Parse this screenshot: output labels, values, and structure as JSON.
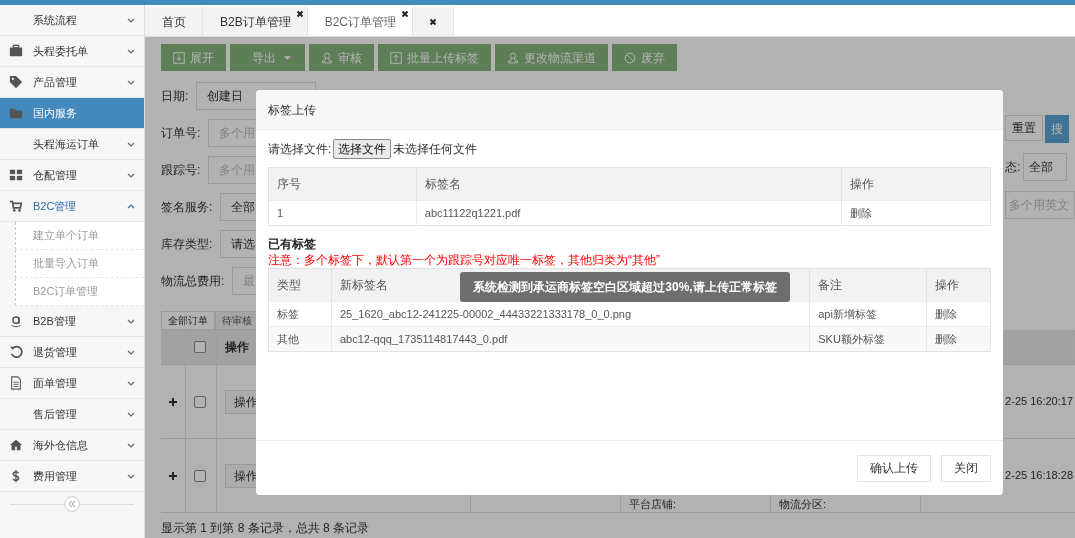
{
  "sidebar": {
    "items": [
      {
        "label": "系统流程",
        "selected": false,
        "expanded": false
      },
      {
        "label": "头程委托单",
        "selected": false,
        "expanded": false
      },
      {
        "label": "产品管理",
        "selected": false,
        "expanded": false
      },
      {
        "label": "国内服务",
        "selected": true
      },
      {
        "label": "头程海运订单",
        "selected": false,
        "expanded": false
      },
      {
        "label": "仓配管理",
        "selected": false,
        "expanded": false
      },
      {
        "label": "B2C管理",
        "selected": false,
        "expanded": true,
        "children": [
          {
            "label": "建立单个订单",
            "selected": false
          },
          {
            "label": "批量导入订单",
            "selected": false
          },
          {
            "label": "B2C订单管理",
            "selected": false
          }
        ]
      },
      {
        "label": "B2B管理",
        "selected": false,
        "expanded": false
      },
      {
        "label": "退货管理",
        "selected": false,
        "expanded": false
      },
      {
        "label": "面单管理",
        "selected": false,
        "expanded": false
      },
      {
        "label": "售后管理",
        "selected": false,
        "expanded": false
      },
      {
        "label": "海外仓信息",
        "selected": false,
        "expanded": false
      },
      {
        "label": "费用管理",
        "selected": false,
        "expanded": false
      }
    ]
  },
  "tabs": [
    {
      "kind": "page",
      "label": "首页",
      "closable": false,
      "selected": false
    },
    {
      "kind": "page",
      "label": "B2B订单管理",
      "closable": true,
      "selected": false
    },
    {
      "kind": "page",
      "label": "B2C订单管理",
      "closable": true,
      "selected": true
    },
    {
      "kind": "close",
      "selected": false
    }
  ],
  "toolbar": {
    "buttons": [
      {
        "label": "展开"
      },
      {
        "label": "导出",
        "dropdown": true
      },
      {
        "label": "审核"
      },
      {
        "label": "批量上传标签"
      },
      {
        "label": "更改物流渠道"
      },
      {
        "label": "废弃"
      }
    ]
  },
  "filters": [
    {
      "kind": "select",
      "label": "日期:",
      "value": "创建日"
    },
    {
      "kind": "input",
      "label": "订单号:",
      "placeholder": "多个用"
    },
    {
      "kind": "input",
      "label": "跟踪号:",
      "placeholder": "多个用"
    },
    {
      "kind": "select",
      "label": "签名服务:",
      "value": "全部"
    },
    {
      "kind": "select",
      "label": "库存类型:",
      "value": "请选"
    },
    {
      "kind": "input",
      "label": "物流总费用:",
      "placeholder": "最"
    }
  ],
  "filters_right": {
    "reset": "重置",
    "search": "搜",
    "status_label": "态:",
    "status_value": "全部",
    "placeholder": "多个用英文"
  },
  "orders": {
    "tabs": [
      {
        "label": "全部订单",
        "selected": true
      },
      {
        "label": "待审核",
        "selected": false
      }
    ],
    "header": {
      "action": "操作",
      "checked": false
    },
    "rows": [
      {
        "action": "操作",
        "checked": false,
        "time": "2-25 16:20:17"
      },
      {
        "action": "操作",
        "checked": false,
        "shop_label": "平台店铺:",
        "zone_label": "物流分区:",
        "time": "2-25 16:18:28"
      }
    ],
    "footer": "显示第 1 到第 8 条记录，总共 8 条记录"
  },
  "modal": {
    "title": "标签上传",
    "file_label": "请选择文件:",
    "file_button": "选择文件",
    "file_status": "未选择任何文件",
    "upload_table": {
      "columns": [
        "序号",
        "标签名",
        "操作"
      ],
      "rows": [
        [
          "1",
          "abc11122q1221.pdf",
          "删除"
        ]
      ]
    },
    "existing_title": "已有标签",
    "notice": "注意：多个标签下，默认第一个为跟踪号对应唯一标签，其他归类为“其他”",
    "existing_table": {
      "columns": [
        "类型",
        "新标签名",
        "备注",
        "操作"
      ],
      "rows": [
        [
          "标签",
          "25_1620_abc12-241225-00002_44433221333178_0_0.png",
          "api新增标签",
          "删除"
        ],
        [
          "其他",
          "abc12-qqq_1735114817443_0.pdf",
          "SKU额外标签",
          "删除"
        ]
      ]
    },
    "toast": "系统检测到承运商标签空白区域超过30%,请上传正常标签",
    "buttons": [
      "确认上传",
      "关闭"
    ]
  }
}
